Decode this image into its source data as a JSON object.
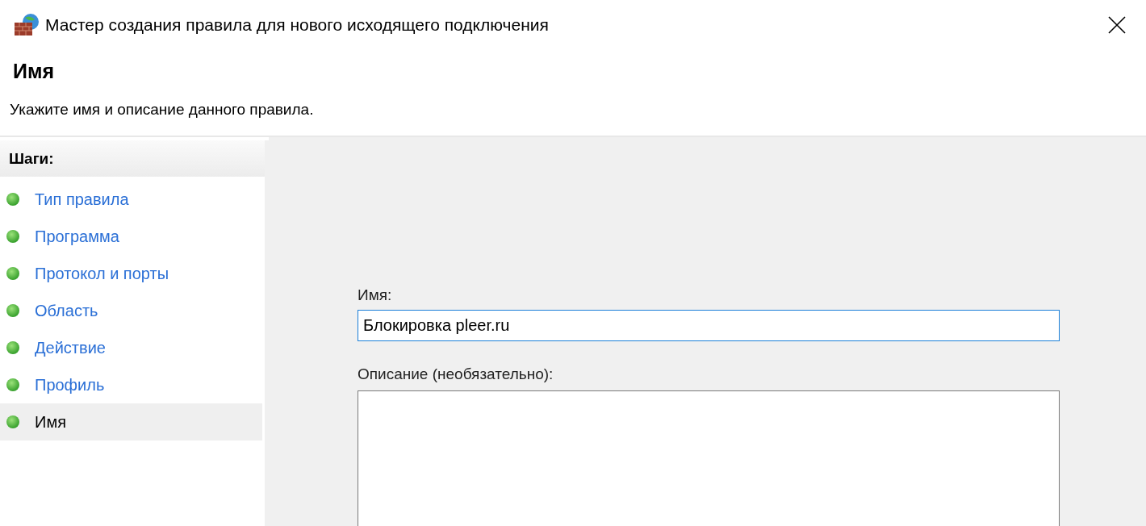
{
  "window": {
    "title": "Мастер создания правила для нового исходящего подключения"
  },
  "header": {
    "title": "Имя",
    "subtitle": "Укажите имя и описание данного правила."
  },
  "steps": {
    "title": "Шаги:",
    "items": [
      {
        "label": "Тип правила",
        "selected": false
      },
      {
        "label": "Программа",
        "selected": false
      },
      {
        "label": "Протокол и порты",
        "selected": false
      },
      {
        "label": "Область",
        "selected": false
      },
      {
        "label": "Действие",
        "selected": false
      },
      {
        "label": "Профиль",
        "selected": false
      },
      {
        "label": "Имя",
        "selected": true
      }
    ]
  },
  "form": {
    "name_label": "Имя:",
    "name_value": "Блокировка pleer.ru",
    "name_focused": true,
    "description_label": "Описание (необязательно):"
  }
}
